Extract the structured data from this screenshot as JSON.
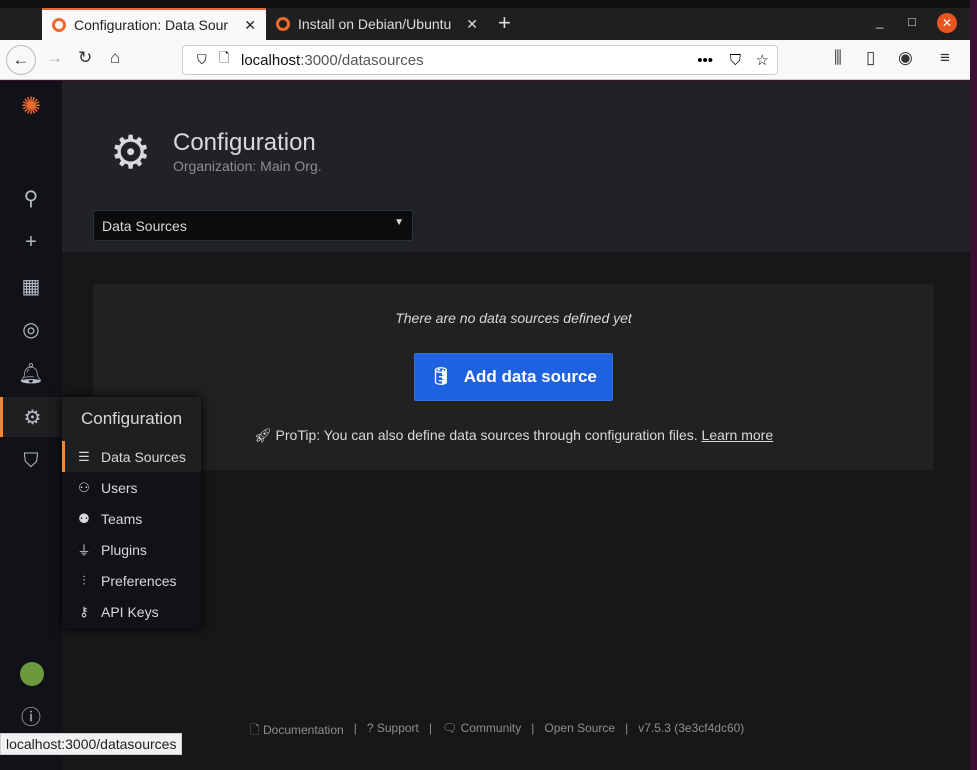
{
  "browser": {
    "tabs": [
      {
        "label": "Configuration: Data Sour",
        "active": true
      },
      {
        "label": "Install on Debian/Ubuntu",
        "active": false
      }
    ],
    "url_host": "localhost",
    "url_path": ":3000/datasources",
    "status_url": "localhost:3000/datasources"
  },
  "header": {
    "title": "Configuration",
    "subtitle": "Organization: Main Org.",
    "select_value": "Data Sources"
  },
  "empty": {
    "message": "There are no data sources defined yet",
    "add_button": "Add data source",
    "protip": "ProTip: You can also define data sources through configuration files.",
    "learn_more": "Learn more"
  },
  "menu": {
    "title": "Configuration",
    "items": [
      {
        "label": "Data Sources",
        "icon": "database-icon"
      },
      {
        "label": "Users",
        "icon": "user-icon"
      },
      {
        "label": "Teams",
        "icon": "users-icon"
      },
      {
        "label": "Plugins",
        "icon": "plug-icon"
      },
      {
        "label": "Preferences",
        "icon": "sliders-icon"
      },
      {
        "label": "API Keys",
        "icon": "key-icon"
      }
    ]
  },
  "footer": {
    "documentation": "Documentation",
    "support": "Support",
    "community": "Community",
    "open_source": "Open Source",
    "version": "v7.5.3 (3e3cf4dc60)"
  },
  "colors": {
    "accent": "#f58733",
    "primary_button": "#1f62e0"
  }
}
